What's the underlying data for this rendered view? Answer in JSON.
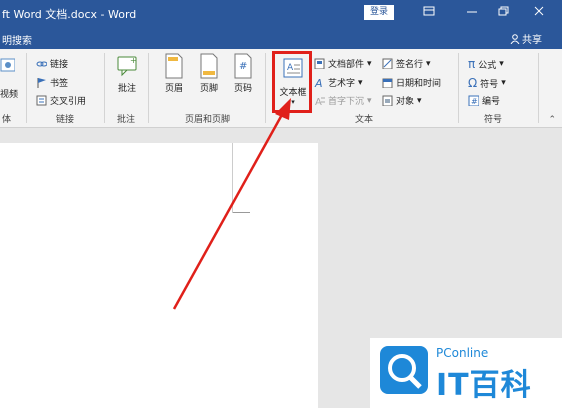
{
  "window": {
    "title": "ft Word 文档.docx - Word"
  },
  "titlebar": {
    "login": "登录",
    "icons": [
      "ribbon-display-icon",
      "minimize-icon",
      "restore-icon",
      "close-icon"
    ]
  },
  "tellbar": {
    "text": "明搜索",
    "share": "共享"
  },
  "ribbon": {
    "media": {
      "partial_label": "视频",
      "group": "体"
    },
    "links": {
      "items": [
        "链接",
        "书签",
        "交叉引用"
      ],
      "group": "链接"
    },
    "comments": {
      "button": "批注",
      "group": "批注"
    },
    "header_footer": {
      "buttons": [
        "页眉",
        "页脚",
        "页码"
      ],
      "group": "页眉和页脚"
    },
    "text": {
      "textbox": "文本框",
      "items_col1": [
        "文档部件",
        "艺术字",
        "首字下沉"
      ],
      "items_col2": [
        "签名行",
        "日期和时间",
        "对象"
      ],
      "group": "文本"
    },
    "symbols": {
      "items": [
        "公式",
        "符号",
        "编号"
      ],
      "group": "符号"
    }
  },
  "watermark": {
    "small": "PConline",
    "big": "IT百科"
  },
  "colors": {
    "titlebar": "#2b579a",
    "highlight": "#e0201a",
    "watermark": "#1e88d8"
  }
}
